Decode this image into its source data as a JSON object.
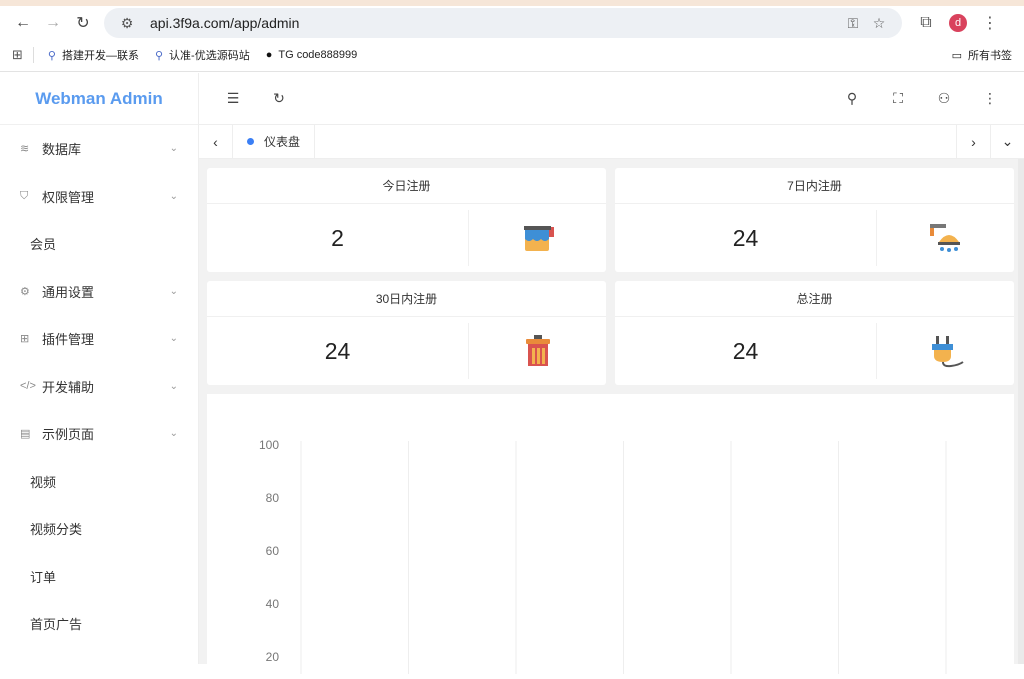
{
  "browser": {
    "url": "api.3f9a.com/app/admin",
    "profile_initial": "d",
    "bookmarks": [
      "搭建开发—联系",
      "认准-优选源码站",
      "TG code888999"
    ],
    "bookmarks_folder": "所有书签"
  },
  "app": {
    "logo": "Webman Admin",
    "menu": [
      {
        "label": "数据库",
        "icon": "database-icon",
        "expandable": true
      },
      {
        "label": "权限管理",
        "icon": "shield-icon",
        "expandable": true
      },
      {
        "label": "会员",
        "icon": "",
        "expandable": false
      },
      {
        "label": "通用设置",
        "icon": "gear-icon",
        "expandable": true
      },
      {
        "label": "插件管理",
        "icon": "plugin-icon",
        "expandable": true
      },
      {
        "label": "开发辅助",
        "icon": "code-icon",
        "expandable": true
      },
      {
        "label": "示例页面",
        "icon": "page-icon",
        "expandable": true
      },
      {
        "label": "视频",
        "icon": "",
        "expandable": false
      },
      {
        "label": "视频分类",
        "icon": "",
        "expandable": false
      },
      {
        "label": "订单",
        "icon": "",
        "expandable": false
      },
      {
        "label": "首页广告",
        "icon": "",
        "expandable": false
      }
    ],
    "active_tab": "仪表盘",
    "cards": [
      {
        "title": "今日注册",
        "value": "2",
        "icon": "paint-bucket-icon"
      },
      {
        "title": "7日内注册",
        "value": "24",
        "icon": "shower-icon"
      },
      {
        "title": "30日内注册",
        "value": "24",
        "icon": "trash-can-icon"
      },
      {
        "title": "总注册",
        "value": "24",
        "icon": "plug-icon"
      }
    ]
  },
  "chart_data": {
    "type": "line",
    "title": "",
    "xlabel": "",
    "ylabel": "",
    "y_ticks": [
      "100",
      "80",
      "60",
      "40",
      "20"
    ],
    "ylim": [
      0,
      100
    ],
    "grid": true,
    "series": []
  }
}
